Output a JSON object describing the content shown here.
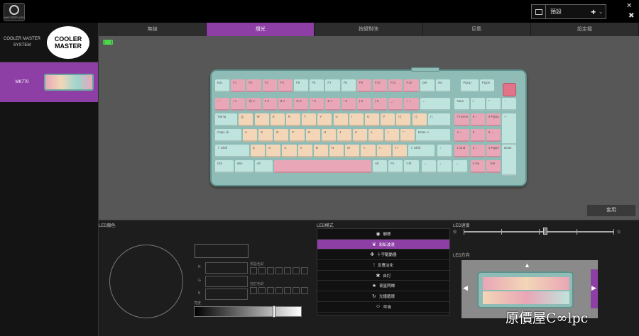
{
  "app": {
    "logo_text": "MASTERPLUS+"
  },
  "profile": {
    "name": "預設",
    "plus": "+",
    "chevron": "⌄"
  },
  "window": {
    "close": "✕",
    "pin": "✖"
  },
  "sidebar": {
    "brand_label": "COOLER MASTER SYSTEM",
    "brand_logo": "COOLER MASTER",
    "device_label": "MK770"
  },
  "tabs": [
    "無線",
    "燈光",
    "按鍵對映",
    "巨集",
    "設定檔"
  ],
  "keyboard": {
    "rows": [
      [
        "Esc",
        "F1",
        "F2",
        "F3",
        "F4",
        "F5",
        "F6",
        "F7",
        "F8",
        "F9",
        "F10",
        "F11",
        "F12",
        "Del",
        "Ins",
        "PgUp",
        "PgDn"
      ],
      [
        "~ `",
        "! 1",
        "@ 2",
        "# 3",
        "$ 4",
        "% 5",
        "^ 6",
        "& 7",
        "* 8",
        "( 9",
        ") 0",
        "_ -",
        "+ =",
        "←",
        "Num",
        "/",
        "*",
        "-"
      ],
      [
        "Tab ↹",
        "Q",
        "W",
        "E",
        "R",
        "T",
        "Y",
        "U",
        "I",
        "O",
        "P",
        "{ [",
        "} ]",
        "| \\",
        "7 Home",
        "8 ↑",
        "9 PgUp",
        "+"
      ],
      [
        "Caps Lk",
        "A",
        "S",
        "D",
        "F",
        "G",
        "H",
        "J",
        "K",
        "L",
        ": ;",
        "\" '",
        "Enter ↵",
        "4 ←",
        "5",
        "6 →"
      ],
      [
        "⇧ Shift",
        "Z",
        "X",
        "C",
        "V",
        "B",
        "N",
        "M",
        "< ,",
        "> .",
        "? /",
        "⇧ Shift",
        "↑",
        "1 End",
        "2 ↓",
        "3 PgDn",
        "Enter"
      ],
      [
        "Ctrl",
        "Win",
        "Alt",
        "",
        "Alt",
        "Fn",
        "Ctrl",
        "←",
        "↓",
        "→",
        "0 Ins",
        ". Del"
      ]
    ]
  },
  "apply_label": "套用",
  "led_color": {
    "title": "LED顏色",
    "r": "R",
    "g": "G",
    "b": "B",
    "preset_label": "預設色彩",
    "custom_label": "自訂色彩",
    "brightness_label": "亮度"
  },
  "led_mode": {
    "title": "LED模式",
    "modes": [
      {
        "icon": "◉",
        "label": "靜態"
      },
      {
        "icon": "❦",
        "label": "彩虹波浪"
      },
      {
        "icon": "✥",
        "label": "十字驅動器"
      },
      {
        "icon": "⁝",
        "label": "反應淡化"
      },
      {
        "icon": "✱",
        "label": "自訂"
      },
      {
        "icon": "★",
        "label": "夜星閃爍"
      },
      {
        "icon": "↻",
        "label": "光譜循環"
      },
      {
        "icon": "☺",
        "label": "呼吸"
      }
    ],
    "active_index": 1
  },
  "led_speed": {
    "title": "LED速度",
    "slow": "慢",
    "fast": "快"
  },
  "led_direction": {
    "title": "LED方向",
    "up": "▲",
    "left": "◀",
    "right": "▶"
  },
  "watermark": "原價屋C∞lpc",
  "colors": {
    "accent": "#8d3fa6",
    "battery": "#4ad84a"
  }
}
